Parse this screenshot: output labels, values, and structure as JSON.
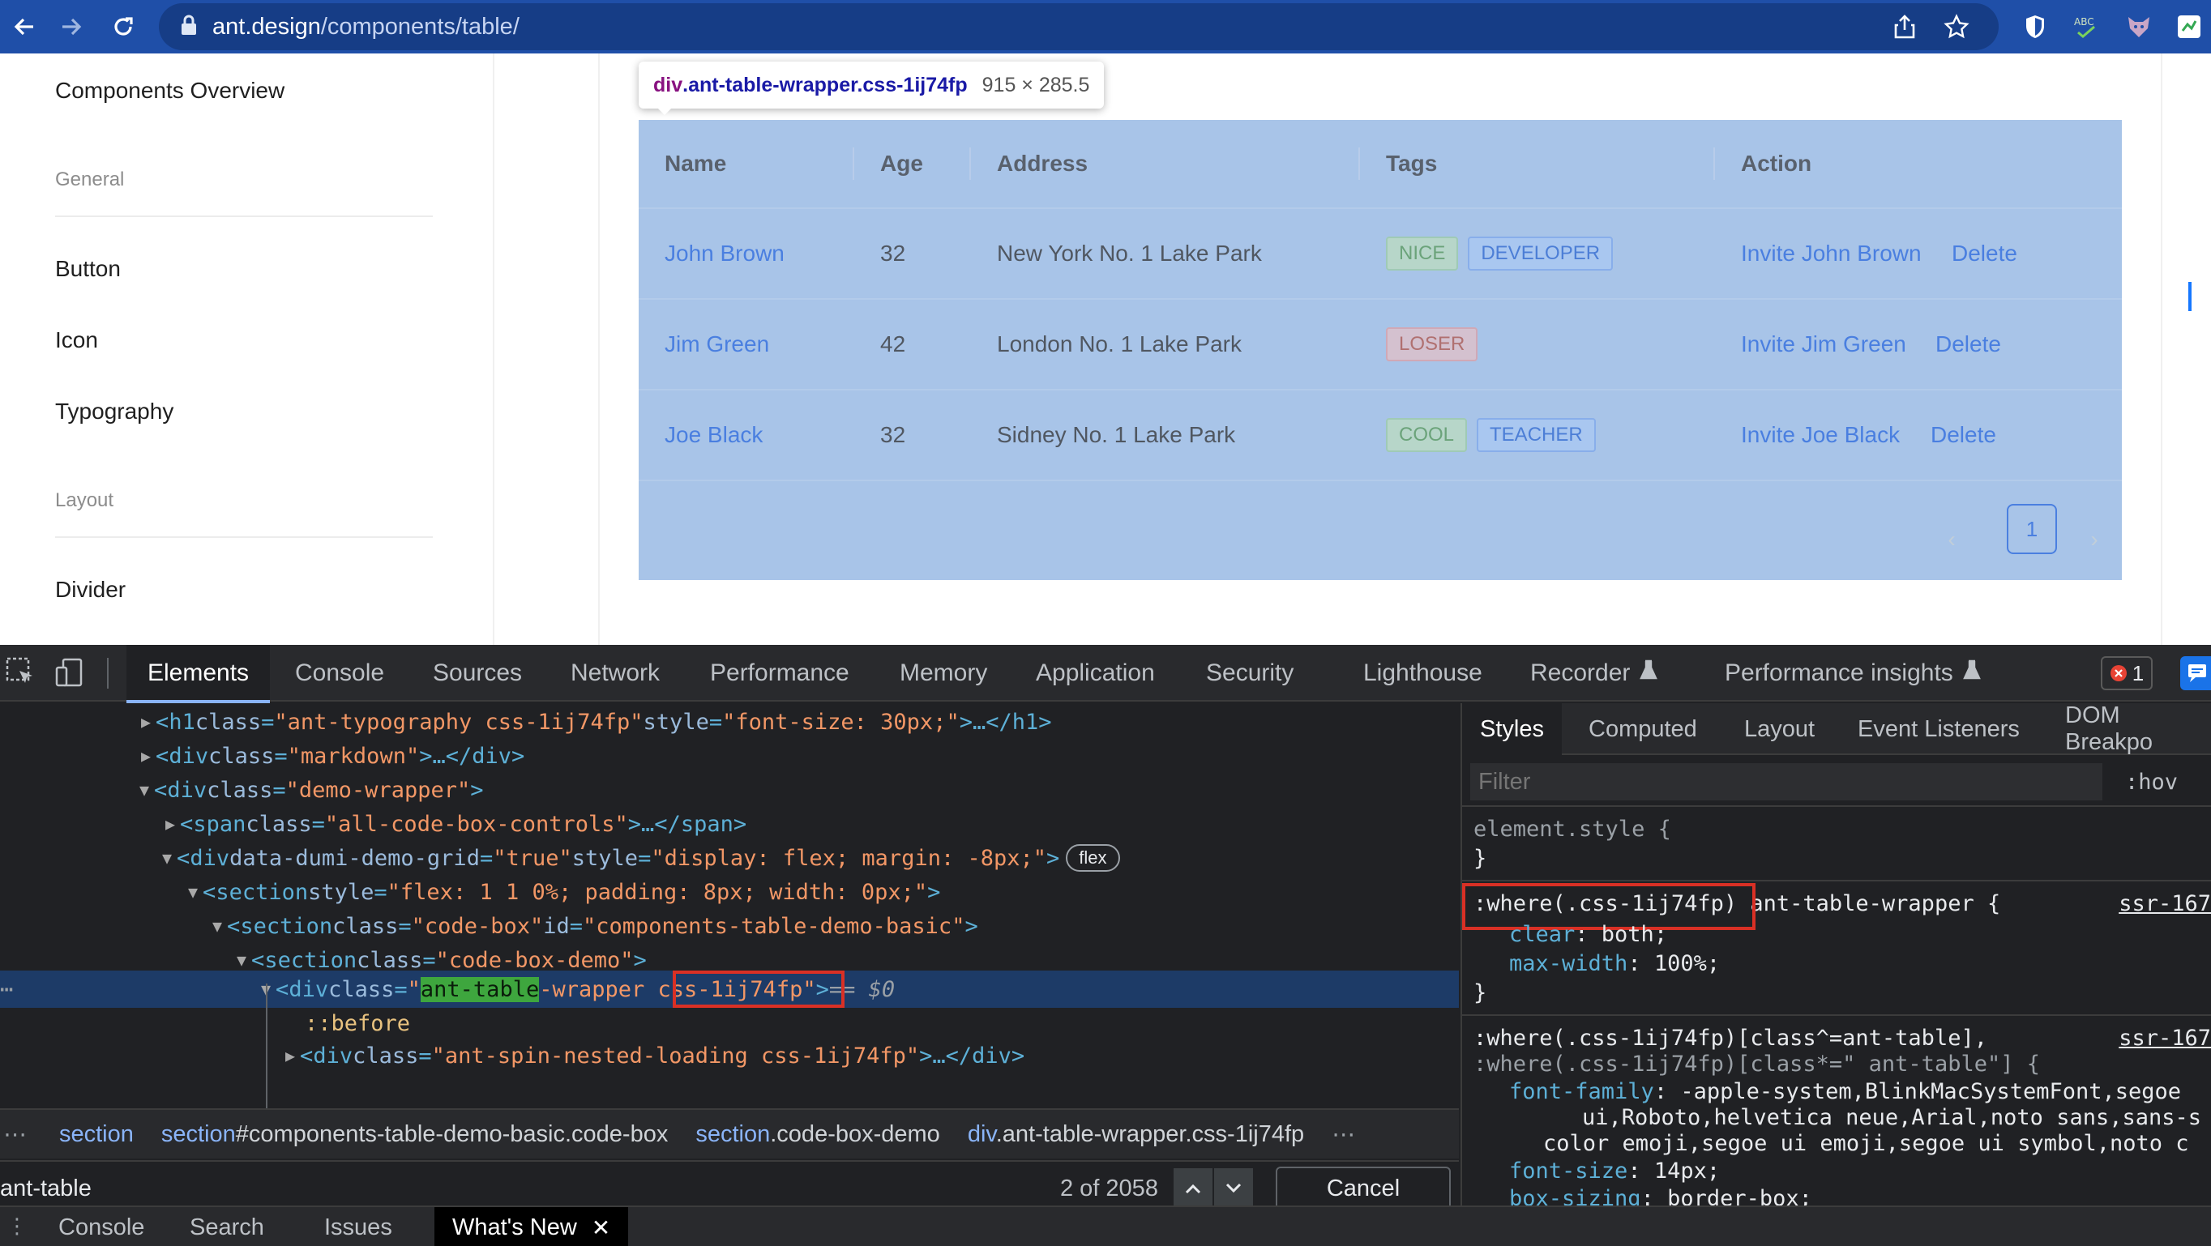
{
  "browser": {
    "url_host": "ant.design",
    "url_path": "/components/table/"
  },
  "sidenav": {
    "overview": "Components Overview",
    "group_general": "General",
    "items_general": [
      "Button",
      "Icon",
      "Typography"
    ],
    "group_layout": "Layout",
    "items_layout": [
      "Divider"
    ]
  },
  "tooltip": {
    "tag": "div",
    "classes": ".ant-table-wrapper.css-1ij74fp",
    "dims": "915 × 285.5"
  },
  "table": {
    "columns": [
      "Name",
      "Age",
      "Address",
      "Tags",
      "Action"
    ],
    "rows": [
      {
        "name": "John Brown",
        "age": "32",
        "address": "New York No. 1 Lake Park",
        "tags": [
          "NICE",
          "DEVELOPER"
        ],
        "invite": "Invite John Brown",
        "delete": "Delete"
      },
      {
        "name": "Jim Green",
        "age": "42",
        "address": "London No. 1 Lake Park",
        "tags": [
          "LOSER"
        ],
        "invite": "Invite Jim Green",
        "delete": "Delete"
      },
      {
        "name": "Joe Black",
        "age": "32",
        "address": "Sidney No. 1 Lake Park",
        "tags": [
          "COOL",
          "TEACHER"
        ],
        "invite": "Invite Joe Black",
        "delete": "Delete"
      }
    ],
    "pager": {
      "prev": "‹",
      "page": "1",
      "next": "›"
    }
  },
  "devtools": {
    "tabs": [
      "Elements",
      "Console",
      "Sources",
      "Network",
      "Performance",
      "Memory",
      "Application",
      "Security",
      "Lighthouse",
      "Recorder",
      "Performance insights"
    ],
    "error_count": "1",
    "dom": {
      "l1": {
        "tag": "h1",
        "attr": "class",
        "val": "ant-typography css-1ij74fp",
        "attr2": "style",
        "val2": "font-size: 30px;",
        "rest": ">…</h1>"
      },
      "l2": {
        "tag": "div",
        "attr": "class",
        "val": "markdown",
        "rest": ">…</div>"
      },
      "l3": {
        "tag": "div",
        "attr": "class",
        "val": "demo-wrapper"
      },
      "l4": {
        "tag": "span",
        "attr": "class",
        "val": "all-code-box-controls",
        "rest": ">…</span>"
      },
      "l5": {
        "tag": "div",
        "attr": "data-dumi-demo-grid",
        "val": "true",
        "attr2": "style",
        "val2": "display: flex; margin: -8px;",
        "badge": "flex"
      },
      "l6": {
        "tag": "section",
        "attr": "style",
        "val": "flex: 1 1 0%; padding: 8px; width: 0px;"
      },
      "l7": {
        "tag": "section",
        "attr": "class",
        "val": "code-box",
        "attr2": "id",
        "val2": "components-table-demo-basic"
      },
      "l8": {
        "tag": "section",
        "attr": "class",
        "val": "code-box-demo"
      },
      "l9": {
        "tag": "div",
        "attr": "class",
        "hl": "ant-table",
        "val_a": "-wrapper ",
        "val_b": "css-1ij74fp",
        "eq": "== $0"
      },
      "l10": {
        "pseudo": "::before"
      },
      "l11": {
        "tag": "div",
        "attr": "class",
        "val": "ant-spin-nested-loading css-1ij74fp",
        "rest": ">…</div>"
      }
    },
    "breadcrumbs": [
      {
        "main": "section",
        "sub": ""
      },
      {
        "main": "section",
        "sub": "#components-table-demo-basic.code-box"
      },
      {
        "main": "section",
        "sub": ".code-box-demo"
      },
      {
        "main": "div",
        "sub": ".ant-table-wrapper.css-1ij74fp"
      }
    ],
    "search": {
      "value": "ant-table",
      "count": "2 of 2058",
      "cancel": "Cancel"
    },
    "drawer_tabs": [
      "Console",
      "Search",
      "Issues",
      "What's New"
    ],
    "styles_tabs": [
      "Styles",
      "Computed",
      "Layout",
      "Event Listeners",
      "DOM Breakpo"
    ],
    "filter_placeholder": "Filter",
    "hov": ":hov",
    "styles": {
      "element_style": "element.style {",
      "close": "}",
      "rule1_where": ":where(.css-1ij74fp)",
      "rule1_sel": " ant-table-wrapper {",
      "rule1_src": "ssr-167",
      "rule1_p1": "clear",
      "rule1_v1": ": both;",
      "rule1_p2": "max-width",
      "rule1_v2": ": 100%;",
      "rule2_sel1": ":where(.css-1ij74fp)[class^=ant-table],",
      "rule2_sel2": ":where(.css-1ij74fp)[class*=\" ant-table\"] {",
      "rule2_src": "ssr-167",
      "rule2_p1": "font-family",
      "rule2_v1a": ": -apple-system,BlinkMacSystemFont,segoe",
      "rule2_v1b": "ui,Roboto,helvetica neue,Arial,noto sans,sans-s",
      "rule2_v1c": "color emoji,segoe ui emoji,segoe ui symbol,noto c",
      "rule2_p2": "font-size",
      "rule2_v2": ": 14px;",
      "rule2_p3": "box-sizing",
      "rule2_v3": ": border-box;"
    }
  },
  "colors": {
    "accent": "#1677ff",
    "selection": "#a8c4e8",
    "devtools_bg": "#202124"
  }
}
